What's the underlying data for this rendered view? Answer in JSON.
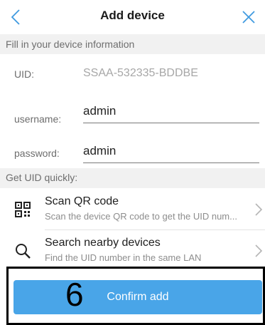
{
  "header": {
    "title": "Add device"
  },
  "sections": {
    "device_info": "Fill in your device information",
    "get_uid": "Get UID quickly:"
  },
  "form": {
    "uid_label": "UID:",
    "uid_value": "SSAA-532335-BDDBE",
    "username_label": "username:",
    "username_value": "admin",
    "password_label": "password:",
    "password_value": "admin"
  },
  "options": [
    {
      "title": "Scan QR code",
      "subtitle": "Scan the device QR code to get the UID num...",
      "icon": "qr-code-icon"
    },
    {
      "title": "Search nearby devices",
      "subtitle": "Find the UID number in the same LAN",
      "icon": "search-icon"
    }
  ],
  "footer": {
    "annotation": "6",
    "confirm_label": "Confirm add"
  },
  "colors": {
    "accent": "#49a5e8",
    "section_bg": "#f1f1f1"
  }
}
